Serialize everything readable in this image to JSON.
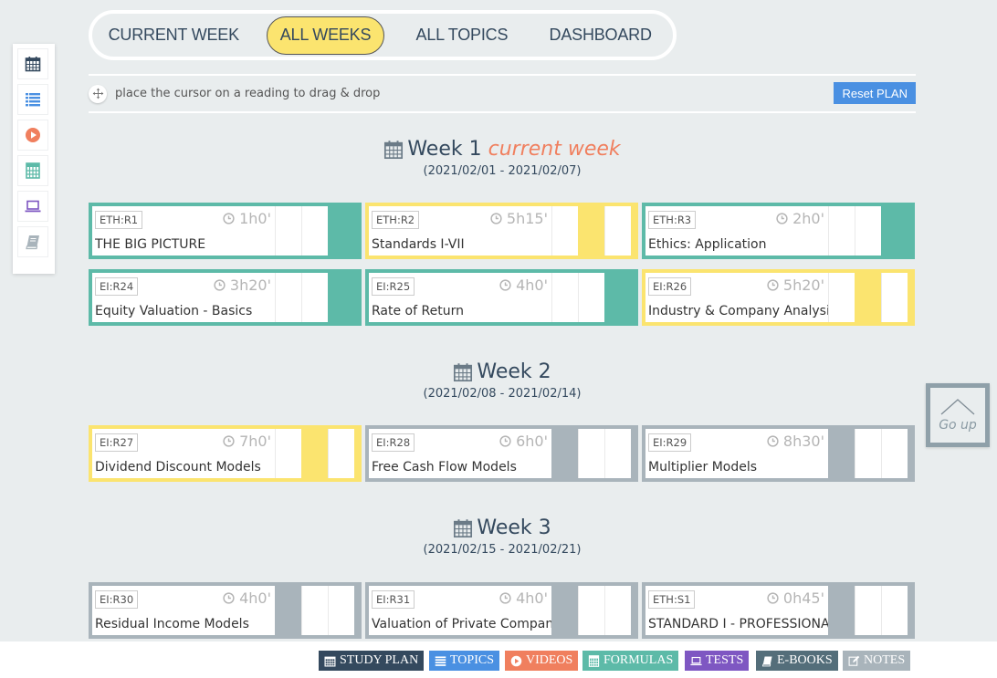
{
  "topnav": {
    "tabs": [
      {
        "label": "CURRENT WEEK",
        "active": false
      },
      {
        "label": "ALL WEEKS",
        "active": true
      },
      {
        "label": "ALL TOPICS",
        "active": false
      },
      {
        "label": "DASHBOARD",
        "active": false
      }
    ]
  },
  "sidebar": {
    "items": [
      {
        "icon": "calendar-icon",
        "color": "#34495e"
      },
      {
        "icon": "list-icon",
        "color": "#4a90e2"
      },
      {
        "icon": "play-circle-icon",
        "color": "#f07f5e"
      },
      {
        "icon": "calculator-icon",
        "color": "#5dbaa8"
      },
      {
        "icon": "laptop-icon",
        "color": "#7e57c2"
      },
      {
        "icon": "book-icon",
        "color": "#a9b4bb"
      }
    ]
  },
  "hint": {
    "text": "place the cursor on a reading to drag & drop",
    "reset_label": "Reset PLAN"
  },
  "weeks": [
    {
      "title": "Week 1",
      "current_label": "current week",
      "dates": "(2021/02/01 - 2021/02/07)",
      "readings": [
        {
          "code": "ETH:R1",
          "time": "1h0'",
          "name": "THE BIG PICTURE",
          "status": "teal"
        },
        {
          "code": "ETH:R2",
          "time": "5h15'",
          "name": "Standards I-VII",
          "status": "yellow"
        },
        {
          "code": "ETH:R3",
          "time": "2h0'",
          "name": "Ethics: Application",
          "status": "teal"
        },
        {
          "code": "EI:R24",
          "time": "3h20'",
          "name": "Equity Valuation - Basics",
          "status": "teal"
        },
        {
          "code": "EI:R25",
          "time": "4h0'",
          "name": "Rate of Return",
          "status": "teal"
        },
        {
          "code": "EI:R26",
          "time": "5h20'",
          "name": "Industry & Company Analysis",
          "status": "yellow"
        }
      ]
    },
    {
      "title": "Week 2",
      "current_label": "",
      "dates": "(2021/02/08 - 2021/02/14)",
      "readings": [
        {
          "code": "EI:R27",
          "time": "7h0'",
          "name": "Dividend Discount Models",
          "status": "yellow"
        },
        {
          "code": "EI:R28",
          "time": "6h0'",
          "name": "Free Cash Flow Models",
          "status": "grey"
        },
        {
          "code": "EI:R29",
          "time": "8h30'",
          "name": "Multiplier Models",
          "status": "grey"
        }
      ]
    },
    {
      "title": "Week 3",
      "current_label": "",
      "dates": "(2021/02/15 - 2021/02/21)",
      "readings": [
        {
          "code": "EI:R30",
          "time": "4h0'",
          "name": "Residual Income Models",
          "status": "grey"
        },
        {
          "code": "EI:R31",
          "time": "4h0'",
          "name": "Valuation of Private Companies",
          "status": "grey"
        },
        {
          "code": "ETH:S1",
          "time": "0h45'",
          "name": "STANDARD I - PROFESSIONALISM",
          "status": "grey"
        }
      ]
    }
  ],
  "goup": {
    "label": "Go up"
  },
  "bottombar": {
    "buttons": [
      {
        "label": "STUDY PLAN",
        "icon": "calendar-icon",
        "color": "#34495e"
      },
      {
        "label": "TOPICS",
        "icon": "list-icon",
        "color": "#4a90e2"
      },
      {
        "label": "VIDEOS",
        "icon": "play-circle-icon",
        "color": "#f07f5e"
      },
      {
        "label": "FORMULAS",
        "icon": "calculator-icon",
        "color": "#5dbaa8"
      },
      {
        "label": "TESTS",
        "icon": "laptop-icon",
        "color": "#7e57c2"
      },
      {
        "label": "E-BOOKS",
        "icon": "book-icon",
        "color": "#546e7a"
      },
      {
        "label": "NOTES",
        "icon": "edit-icon",
        "color": "#a9b4bb"
      }
    ]
  }
}
